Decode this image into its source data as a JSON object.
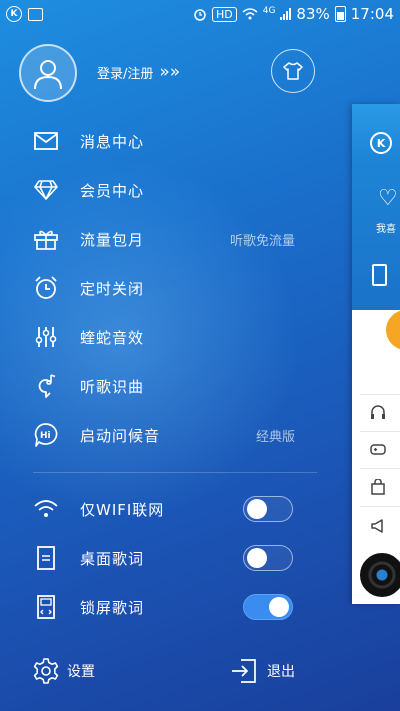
{
  "status_bar": {
    "hd": "HD",
    "network": "4G",
    "battery": "83%",
    "time": "17:04"
  },
  "profile": {
    "login_text": "登录/注册",
    "arrows": "»»"
  },
  "menu": [
    {
      "label": "消息中心",
      "icon": "mail-icon"
    },
    {
      "label": "会员中心",
      "icon": "diamond-icon"
    },
    {
      "label": "流量包月",
      "icon": "gift-icon",
      "sub": "听歌免流量"
    },
    {
      "label": "定时关闭",
      "icon": "alarm-clock-icon"
    },
    {
      "label": "蝰蛇音效",
      "icon": "equalizer-icon"
    },
    {
      "label": "听歌识曲",
      "icon": "music-recognition-icon"
    },
    {
      "label": "启动问候音",
      "icon": "greeting-hi-icon",
      "sub": "经典版"
    }
  ],
  "toggles": [
    {
      "label": "仅WIFI联网",
      "icon": "wifi-icon",
      "state": false
    },
    {
      "label": "桌面歌词",
      "icon": "desktop-lyrics-icon",
      "state": false
    },
    {
      "label": "锁屏歌词",
      "icon": "lockscreen-lyrics-icon",
      "state": true
    }
  ],
  "bottom": {
    "settings": "设置",
    "logout": "退出"
  },
  "peek": {
    "favorites_label": "我喜",
    "k": "K"
  },
  "colors": {
    "accent_toggle": "#3b8cf0",
    "orange": "#f5a623"
  }
}
